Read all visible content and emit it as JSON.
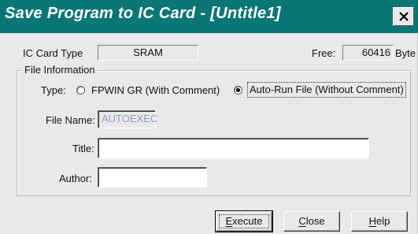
{
  "window": {
    "title": "Save Program to IC Card - [Untitle1]",
    "close_glyph": "×"
  },
  "card": {
    "type_label": "IC Card Type",
    "type_value": "SRAM",
    "free_label": "Free:",
    "free_value": "60416",
    "free_unit": "Byte"
  },
  "file_info": {
    "group_label": "File Information",
    "type_label": "Type:",
    "radio_options": [
      {
        "label": "FPWIN GR (With Comment)",
        "selected": false
      },
      {
        "label": "Auto-Run File (Without Comment)",
        "selected": true
      }
    ],
    "file_name_label": "File Name:",
    "file_name_value": "AUTOEXEC",
    "title_label": "Title:",
    "title_value": "",
    "author_label": "Author:",
    "author_value": ""
  },
  "buttons": {
    "execute": {
      "mnemonic": "E",
      "rest": "xecute"
    },
    "close": {
      "mnemonic": "C",
      "rest": "lose"
    },
    "help": {
      "mnemonic": "H",
      "rest": "elp"
    }
  }
}
